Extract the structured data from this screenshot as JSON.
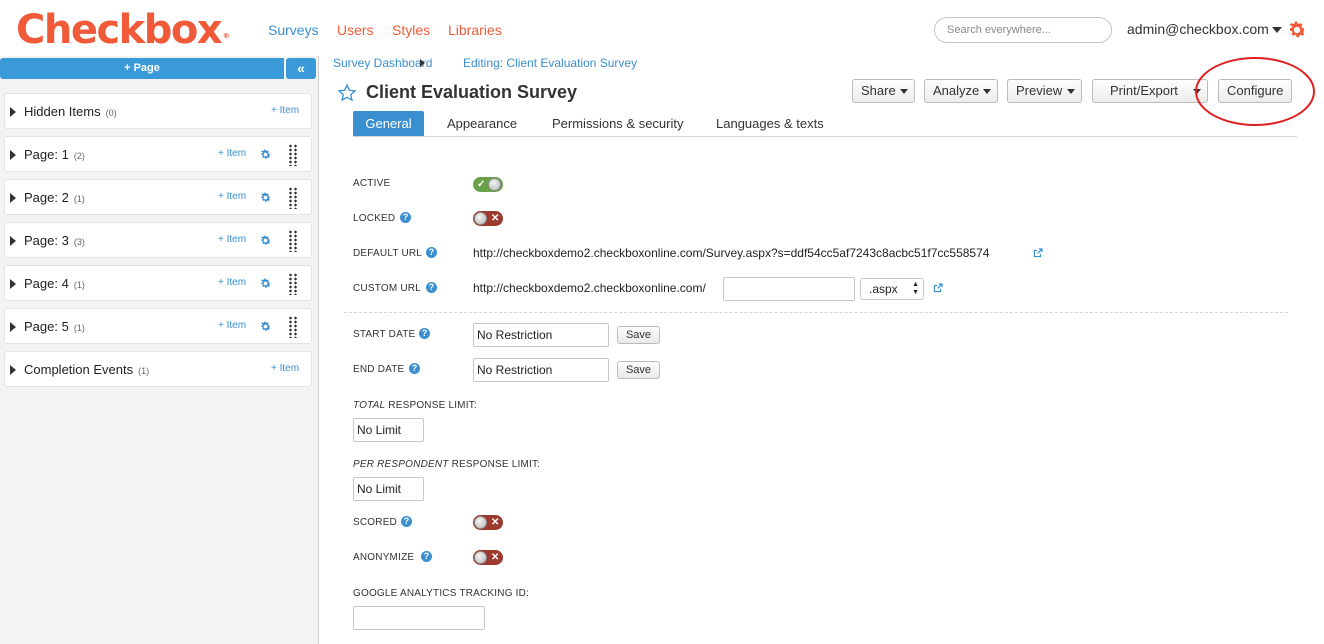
{
  "app": {
    "logo": "Checkbox",
    "registered": "®",
    "nav": [
      {
        "label": "Surveys",
        "color": "#3a8fd0"
      },
      {
        "label": "Users",
        "color": "#f15a38"
      },
      {
        "label": "Styles",
        "color": "#f15a38"
      },
      {
        "label": "Libraries",
        "color": "#f15a38"
      }
    ],
    "search_placeholder": "Search everywhere...",
    "user": "admin@checkbox.com"
  },
  "sidebar": {
    "add_page": "+ Page",
    "collapse_glyph": "«",
    "pages": [
      {
        "title": "Hidden Items",
        "count": "(0)",
        "add_item": "+ Item",
        "has_controls": false
      },
      {
        "title": "Page: 1",
        "count": "(2)",
        "add_item": "+ Item",
        "has_controls": true
      },
      {
        "title": "Page: 2",
        "count": "(1)",
        "add_item": "+ Item",
        "has_controls": true
      },
      {
        "title": "Page: 3",
        "count": "(3)",
        "add_item": "+ Item",
        "has_controls": true
      },
      {
        "title": "Page: 4",
        "count": "(1)",
        "add_item": "+ Item",
        "has_controls": true
      },
      {
        "title": "Page: 5",
        "count": "(1)",
        "add_item": "+ Item",
        "has_controls": true
      },
      {
        "title": "Completion Events",
        "count": "(1)",
        "add_item": "+ Item",
        "has_controls": false
      }
    ]
  },
  "breadcrumb": {
    "dashboard": "Survey Dashboard",
    "current": "Editing: Client Evaluation Survey"
  },
  "survey": {
    "title": "Client Evaluation Survey"
  },
  "toolbar": {
    "share": "Share",
    "analyze": "Analyze",
    "preview": "Preview",
    "print_export": "Print/Export",
    "configure": "Configure"
  },
  "tabs": {
    "general": "General",
    "appearance": "Appearance",
    "permissions": "Permissions & security",
    "languages": "Languages & texts"
  },
  "settings": {
    "active_label": "ACTIVE",
    "active": true,
    "locked_label": "LOCKED",
    "locked": false,
    "default_url_label": "DEFAULT URL",
    "default_url": "http://checkboxdemo2.checkboxonline.com/Survey.aspx?s=ddf54cc5af7243c8acbc51f7cc558574",
    "custom_url_label": "CUSTOM URL",
    "custom_url_prefix": "http://checkboxdemo2.checkboxonline.com/",
    "custom_url_value": "",
    "custom_url_ext": ".aspx",
    "start_date_label": "START DATE",
    "start_date": "No Restriction",
    "end_date_label": "END DATE",
    "end_date": "No Restriction",
    "save": "Save",
    "total_limit_italic": "TOTAL",
    "total_limit_rest": " RESPONSE LIMIT:",
    "total_limit": "No Limit",
    "per_resp_italic": "PER RESPONDENT",
    "per_resp_rest": " RESPONSE LIMIT:",
    "per_resp_limit": "No Limit",
    "scored_label": "SCORED",
    "scored": false,
    "anonymize_label": "ANONYMIZE",
    "anonymize": false,
    "ga_label": "GOOGLE ANALYTICS TRACKING ID:",
    "ga_value": ""
  },
  "colors": {
    "brand": "#f15a38",
    "accent": "#3a8fd0",
    "toggle_on": "#6aa14a",
    "toggle_off": "#9c3a30",
    "highlight_circle": "#e02020"
  }
}
